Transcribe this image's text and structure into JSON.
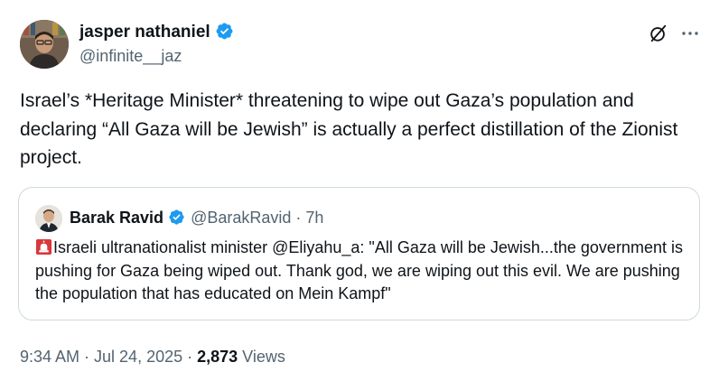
{
  "author": {
    "name": "jasper nathaniel",
    "handle": "@infinite__jaz",
    "verified_color": "#1d9bf0"
  },
  "tweet": {
    "text": "Israel’s *Heritage Minister* threatening to wipe out Gaza’s population and declaring “All Gaza will be Jewish” is actually a perfect distillation of the Zionist project."
  },
  "quote": {
    "name": "Barak Ravid",
    "meta": "@BarakRavid · 7h",
    "emoji_icon": "rotating-light-icon",
    "text": "Israeli ultranationalist minister @Eliyahu_a: \"All Gaza will be Jewish...the government is pushing for Gaza being wiped out. Thank god, we are wiping out this evil. We are pushing the population that has educated on Mein Kampf\""
  },
  "footer": {
    "time_date": "9:34 AM · Jul 24, 2025 · ",
    "views_count": "2,873",
    "views_label": " Views"
  },
  "icons": {
    "grok": "grok-icon",
    "more": "more-options-icon"
  }
}
